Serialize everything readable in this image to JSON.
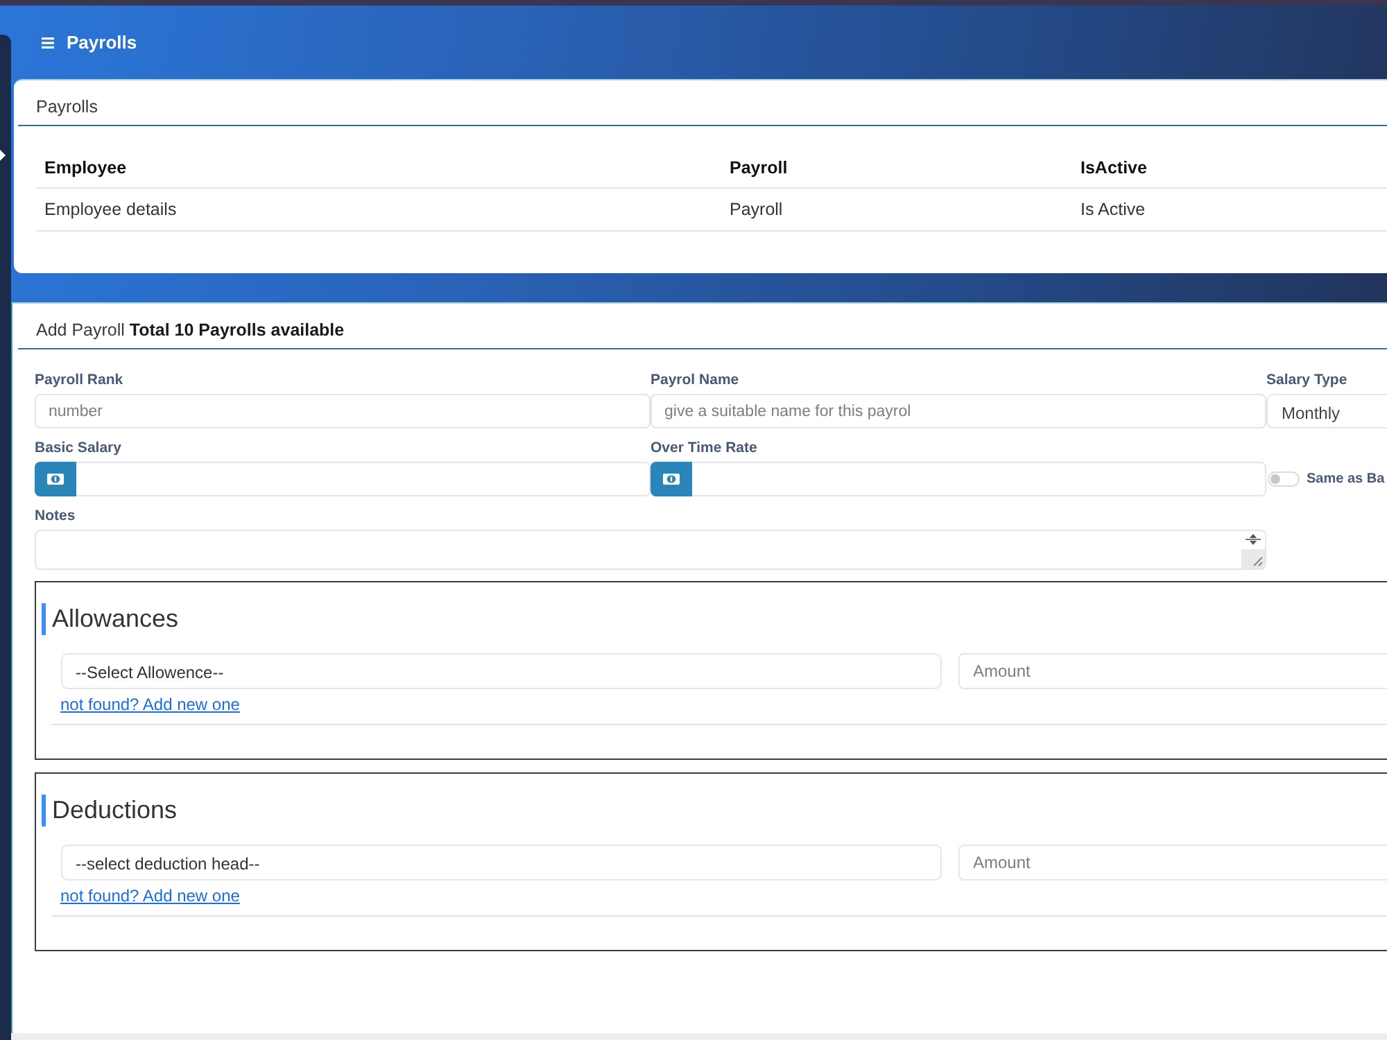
{
  "header": {
    "title": "Payrolls"
  },
  "payrolls_card": {
    "title": "Payrolls",
    "table": {
      "columns": [
        "Employee",
        "Payroll",
        "IsActive"
      ],
      "rows": [
        [
          "Employee details",
          "Payroll",
          "Is Active"
        ]
      ]
    }
  },
  "add_payroll_card": {
    "heading": "Add Payroll **Total 10 Payrolls available**",
    "fields": [
      {
        "kind": "text",
        "label": "Payroll Rank",
        "placeholder": "number"
      },
      {
        "kind": "text",
        "label": "Payrol Name",
        "placeholder": "give a suitable name for this payrol"
      },
      {
        "kind": "select",
        "label": "Salary Type",
        "value": "Monthly"
      },
      {
        "kind": "money",
        "label": "Basic Salary"
      },
      {
        "kind": "money",
        "label": "Over Time Rate"
      },
      {
        "kind": "toggle",
        "label": "Same as Ba",
        "checked": false
      },
      {
        "kind": "textarea",
        "label": "Notes"
      }
    ],
    "sections": [
      {
        "title": "Allowances",
        "select": {
          "value": "--Select Allowence--"
        },
        "amount": {
          "placeholder": "Amount"
        },
        "link": "not found? Add new one"
      },
      {
        "title": "Deductions",
        "select": {
          "value": "--select deduction head--"
        },
        "amount": {
          "placeholder": "Amount"
        },
        "link": "not found? Add new one"
      }
    ]
  }
}
